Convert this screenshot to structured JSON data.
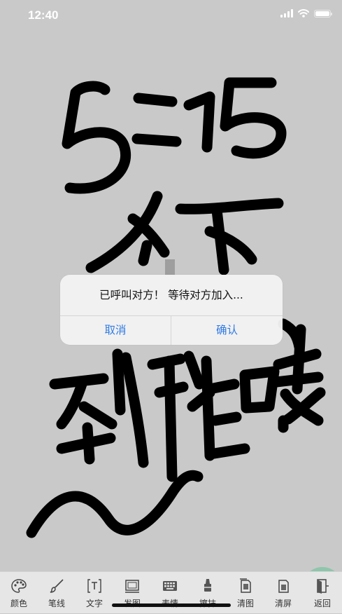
{
  "status_bar": {
    "time": "12:40"
  },
  "canvas": {
    "ink_color": "#000000",
    "background": "#c9c9c9"
  },
  "dialog": {
    "message": "已呼叫对方！ 等待对方加入...",
    "cancel_label": "取消",
    "confirm_label": "确认",
    "button_color": "#2f7ae5"
  },
  "toolbar": {
    "items": [
      {
        "label": "颜色",
        "icon": "palette-icon"
      },
      {
        "label": "笔线",
        "icon": "brush-icon"
      },
      {
        "label": "文字",
        "icon": "text-icon"
      },
      {
        "label": "发图",
        "icon": "image-icon"
      },
      {
        "label": "表情",
        "icon": "keyboard-icon"
      },
      {
        "label": "擦抹",
        "icon": "eraser-icon"
      },
      {
        "label": "清图",
        "icon": "clear-image-icon"
      },
      {
        "label": "清屏",
        "icon": "clear-screen-icon"
      },
      {
        "label": "返回",
        "icon": "exit-door-icon"
      }
    ],
    "back_highlight": "#79c4a0"
  }
}
